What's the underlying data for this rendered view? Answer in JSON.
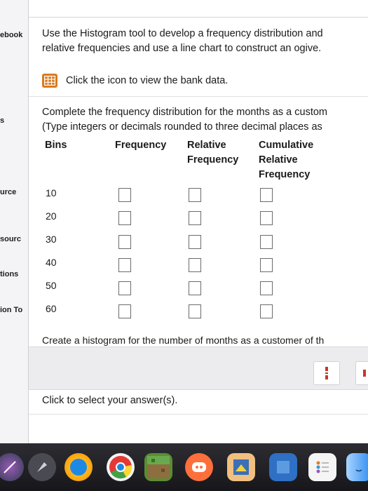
{
  "sidebar": {
    "items": [
      "ebook",
      "s",
      "urce",
      "sourc",
      "tions",
      "ion To"
    ]
  },
  "intro": {
    "line1": "Use the Histogram tool to develop a frequency distribution and",
    "line2": "relative frequencies and use a line chart to construct an ogive."
  },
  "bank": {
    "text": "Click the icon to view the bank data.",
    "icon": "table-icon",
    "icon_color": "#d97a1e"
  },
  "instructions": {
    "line1": "Complete the frequency distribution for the months as a custom",
    "line2": "(Type integers or decimals rounded to three decimal places as"
  },
  "table": {
    "headers": {
      "bins": "Bins",
      "frequency": "Frequency",
      "relative": [
        "Relative",
        "Frequency"
      ],
      "cumulative": [
        "Cumulative",
        "Relative",
        "Frequency"
      ]
    },
    "bins": [
      "10",
      "20",
      "30",
      "40",
      "50",
      "60"
    ]
  },
  "histogram_prompt": "Create a histogram for the number of months as a customer of th",
  "answer_prompt": "Click to select your answer(s).",
  "dock": {
    "icons": [
      "launchpad-icon",
      "rocket-icon",
      "safari-icon",
      "chrome-icon",
      "minecraft-icon",
      "discord-icon",
      "preview-icon",
      "files-icon",
      "reminders-icon",
      "finder-icon"
    ]
  }
}
